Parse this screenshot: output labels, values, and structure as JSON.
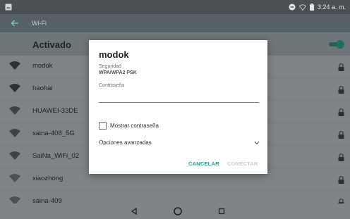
{
  "status_bar": {
    "time": "3:24 a. m."
  },
  "app_bar": {
    "title": "Wi-Fi"
  },
  "wifi_toggle": {
    "label": "Activado",
    "state": "on"
  },
  "networks": [
    {
      "name": "modok",
      "locked": true
    },
    {
      "name": "haohai",
      "locked": true
    },
    {
      "name": "HUAWEI-33DE",
      "locked": true
    },
    {
      "name": "saina-408_5G",
      "locked": true
    },
    {
      "name": "SaiNa_WiFi_02",
      "locked": true
    },
    {
      "name": "xiaozhong",
      "locked": true
    },
    {
      "name": "saina-409",
      "locked": true
    }
  ],
  "dialog": {
    "title": "modok",
    "security_label": "Seguridad",
    "security_value": "WPA/WPA2 PSK",
    "password_label": "Contraseña",
    "password_value": "",
    "show_password_label": "Mostrar contraseña",
    "show_password_checked": false,
    "advanced_label": "Opciones avanzadas",
    "cancel_label": "CANCELAR",
    "connect_label": "CONECTAR"
  },
  "colors": {
    "accent": "#2e9c89",
    "disabled": "#c8cfcd"
  }
}
